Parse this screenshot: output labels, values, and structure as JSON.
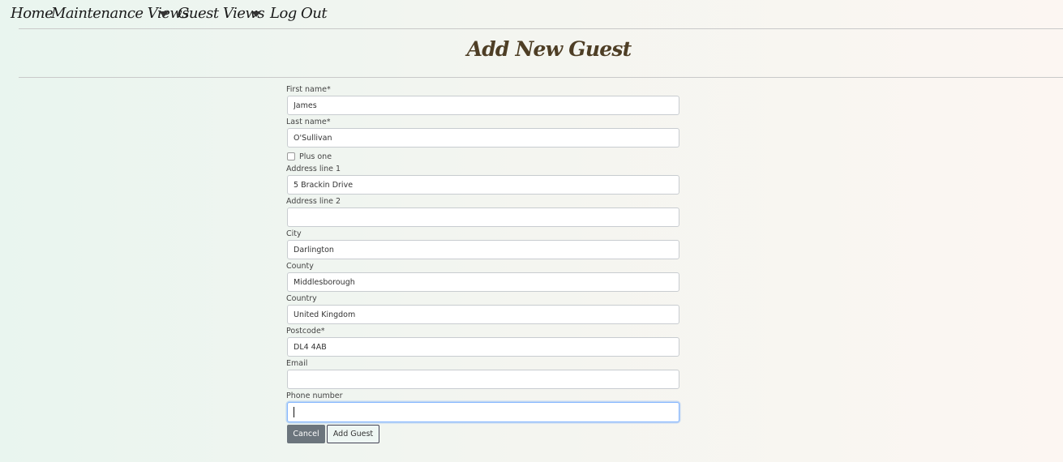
{
  "nav": {
    "home": "Home",
    "maintenance_views": "Maintenance Views",
    "guest_views": "Guest Views",
    "log_out": "Log Out"
  },
  "page": {
    "title": "Add New Guest"
  },
  "form": {
    "first_name": {
      "label": "First name*",
      "value": "James"
    },
    "last_name": {
      "label": "Last name*",
      "value": "O'Sullivan"
    },
    "plus_one": {
      "label": "Plus one",
      "checked": false
    },
    "address_line_1": {
      "label": "Address line 1",
      "value": "5 Brackin Drive"
    },
    "address_line_2": {
      "label": "Address line 2",
      "value": ""
    },
    "city": {
      "label": "City",
      "value": "Darlington"
    },
    "county": {
      "label": "County",
      "value": "Middlesborough"
    },
    "country": {
      "label": "Country",
      "value": "United Kingdom"
    },
    "postcode": {
      "label": "Postcode*",
      "value": "DL4 4AB"
    },
    "email": {
      "label": "Email",
      "value": ""
    },
    "phone_number": {
      "label": "Phone number",
      "value": ""
    }
  },
  "buttons": {
    "cancel": "Cancel",
    "add_guest": "Add Guest"
  },
  "colors": {
    "cancel_button": "#6c757d",
    "title_text": "#4e3e25",
    "focus_ring": "#86b7fe"
  }
}
